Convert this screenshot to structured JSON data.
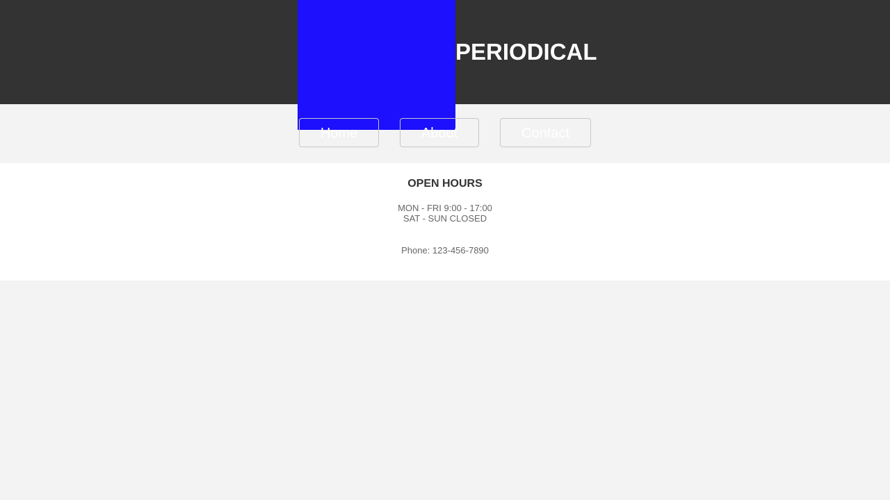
{
  "header": {
    "title": "PERIODICAL",
    "background_color": "#333333",
    "logo_color": "#1c10fd"
  },
  "nav": {
    "items": [
      {
        "label": "Home"
      },
      {
        "label": "About"
      },
      {
        "label": "Contact"
      }
    ]
  },
  "info": {
    "title": "OPEN HOURS",
    "hours": [
      "MON - FRI 9:00 - 17:00",
      "SAT - SUN CLOSED"
    ],
    "phone": "Phone: 123-456-7890"
  }
}
